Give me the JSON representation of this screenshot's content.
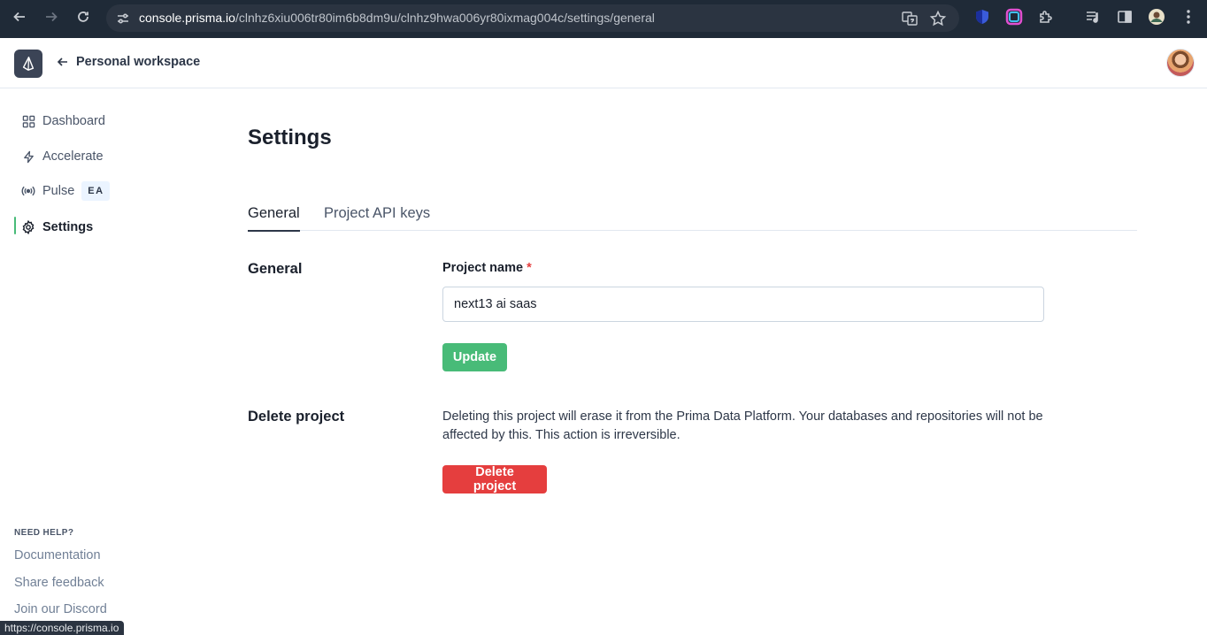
{
  "browser": {
    "url_host": "console.prisma.io",
    "url_path": "/clnhz6xiu006tr80im6b8dm9u/clnhz9hwa006yr80ixmag004c/settings/general",
    "status_url": "https://console.prisma.io"
  },
  "header": {
    "back_label": "Personal workspace"
  },
  "sidebar": {
    "items": [
      {
        "label": "Dashboard",
        "icon": "grid-icon"
      },
      {
        "label": "Accelerate",
        "icon": "lightning-icon"
      },
      {
        "label": "Pulse",
        "icon": "broadcast-icon",
        "badge": "EA"
      },
      {
        "label": "Settings",
        "icon": "gear-icon",
        "active": true
      }
    ],
    "help_title": "NEED HELP?",
    "help_links": [
      "Documentation",
      "Share feedback",
      "Join our Discord"
    ]
  },
  "main": {
    "title": "Settings",
    "tabs": [
      {
        "label": "General",
        "active": true
      },
      {
        "label": "Project API keys",
        "active": false
      }
    ],
    "general": {
      "section_title": "General",
      "field_label": "Project name",
      "required_mark": "*",
      "project_name_value": "next13 ai saas",
      "update_label": "Update"
    },
    "delete": {
      "section_title": "Delete project",
      "description": "Deleting this project will erase it from the Prima Data Platform. Your databases and repositories will not be affected by this. This action is irreversible.",
      "button_label": "Delete project"
    }
  },
  "colors": {
    "accent_green": "#48bb78",
    "danger_red": "#e53e3e",
    "chrome_bg": "#1f2a37"
  }
}
